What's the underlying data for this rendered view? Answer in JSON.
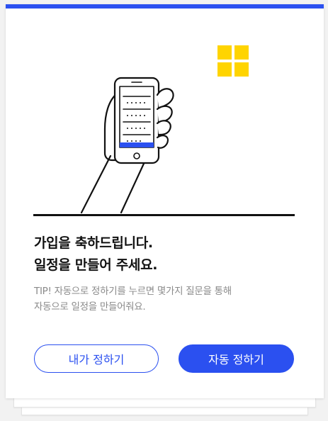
{
  "card": {
    "accent_color": "#2b50f0",
    "logo_color": "#ffd400",
    "illustration": "hand-holding-phone-icon"
  },
  "headline": {
    "line1": "가입을 축하드립니다.",
    "line2": "일정을 만들어 주세요."
  },
  "tip": {
    "line1": "TIP!  자동으로 정하기를 누르면 몇가지 질문을 통해",
    "line2": "자동으로 일정을 만들어줘요."
  },
  "buttons": {
    "manual_label": "내가 정하기",
    "auto_label": "자동 정하기"
  }
}
